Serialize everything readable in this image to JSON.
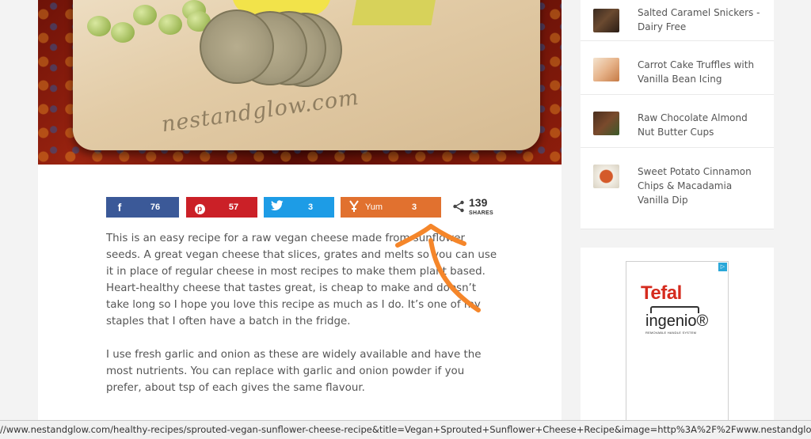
{
  "hero": {
    "watermark": "nestandglow.com"
  },
  "share": {
    "facebook": {
      "icon": "facebook-icon",
      "count": "76",
      "color": "#3b5998"
    },
    "pinterest": {
      "icon": "pinterest-icon",
      "count": "57",
      "color": "#cb2027"
    },
    "twitter": {
      "icon": "twitter-icon",
      "count": "3",
      "color": "#1d9ce6"
    },
    "yummly": {
      "icon": "yummly-icon",
      "label": "Yum",
      "count": "3",
      "color": "#e1712f"
    },
    "total": {
      "icon": "share-icon",
      "count": "139",
      "label": "SHARES"
    }
  },
  "article": {
    "paragraphs": [
      "This is an easy recipe for a raw vegan cheese made from sunflower seeds. A great vegan cheese that slices, grates and melts so you can use it in place of regular cheese in most recipes to make them plant based. Heart-healthy cheese that tastes great, is cheap to make and doesn’t take long so I hope you love this recipe as much as I do. It’s one of my staples that I often have a batch in the fridge.",
      "I use fresh garlic and onion as these are widely available and have the most nutrients. You can replace with garlic and onion powder if you prefer, about tsp of each gives the same flavour."
    ]
  },
  "sidebar": {
    "items": [
      {
        "title": "Salted Caramel Snickers - Dairy Free"
      },
      {
        "title": "Carrot Cake Truffles with Vanilla Bean Icing"
      },
      {
        "title": "Raw Chocolate Almond Nut Butter Cups"
      },
      {
        "title": "Sweet Potato Cinnamon Chips & Macadamia Vanilla Dip"
      }
    ]
  },
  "ad": {
    "brand": "Tefal",
    "product": "ingenio®",
    "tagline": "REMOVABLE HANDLE SYSTEM",
    "badge": "▷"
  },
  "status": {
    "url": "//www.nestandglow.com/healthy-recipes/sprouted-vegan-sunflower-cheese-recipe&title=Vegan+Sprouted+Sunflower+Cheese+Recipe&image=http%3A%2F%2Fwww.nestandglow.com%2Fwp-content%2Fuploads"
  },
  "colors": {
    "annotation_arrow": "#f5862a"
  }
}
